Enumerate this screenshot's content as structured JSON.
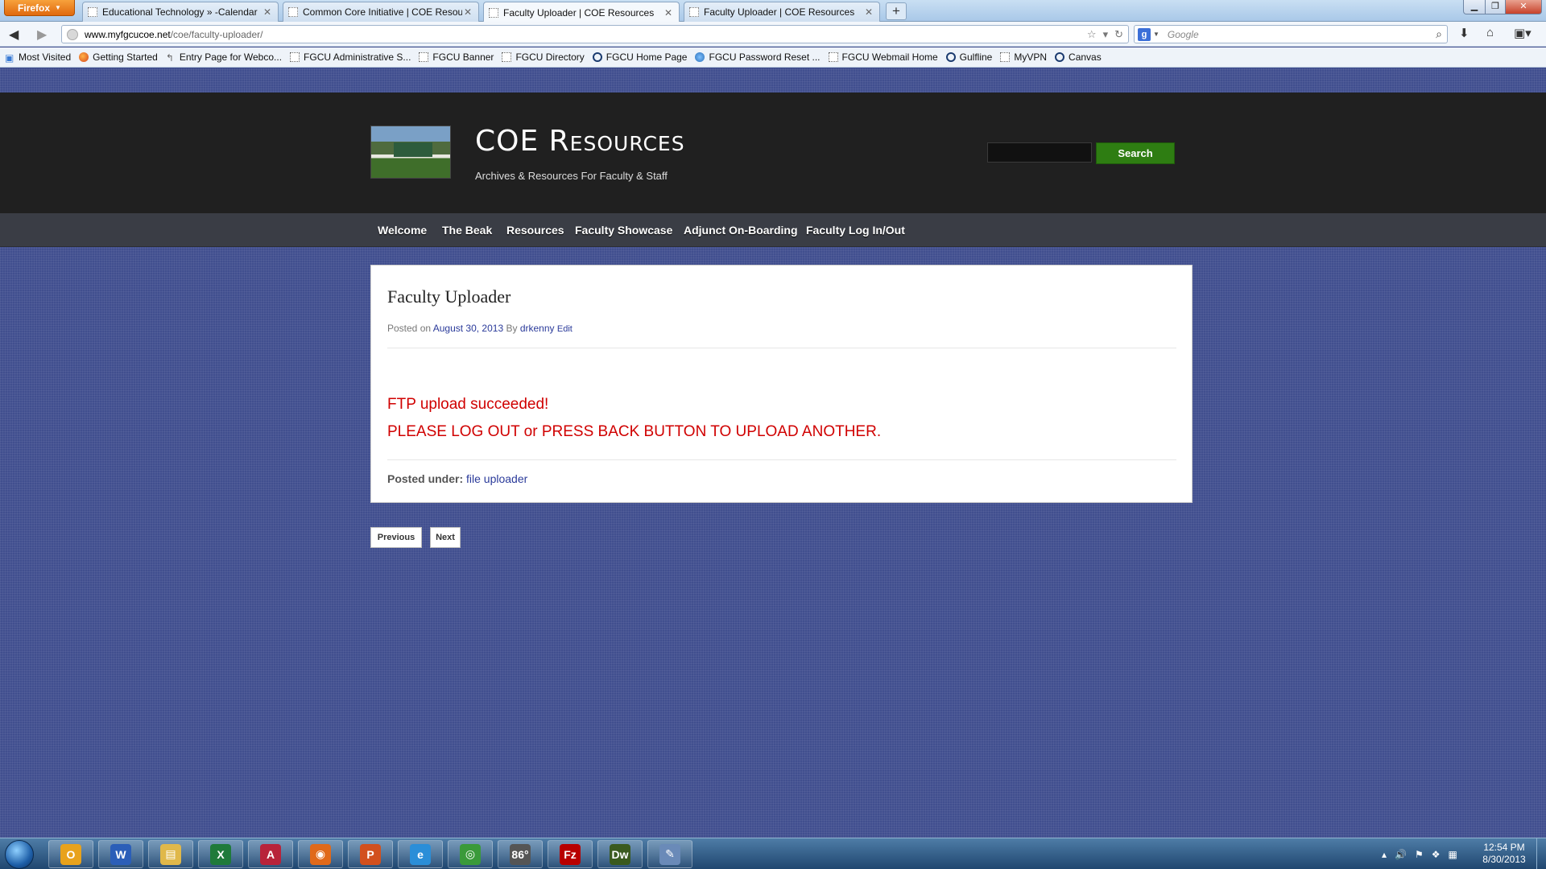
{
  "browser": {
    "app_button": "Firefox",
    "tabs": [
      {
        "label": "Educational Technology » -Calendar",
        "active": false
      },
      {
        "label": "Common Core Initiative | COE Resour...",
        "active": false
      },
      {
        "label": "Faculty Uploader | COE Resources",
        "active": true
      },
      {
        "label": "Faculty Uploader | COE Resources",
        "active": false
      }
    ],
    "new_tab": "+",
    "url_domain": "www.myfgcucoe.net",
    "url_path": "/coe/faculty-uploader/",
    "search_placeholder": "Google",
    "bookmarks": [
      {
        "label": "Most Visited",
        "icon": "star-icon"
      },
      {
        "label": "Getting Started",
        "icon": "firefox-icon"
      },
      {
        "label": "Entry Page for Webco...",
        "icon": "link-icon"
      },
      {
        "label": "FGCU Administrative S...",
        "icon": "page-icon"
      },
      {
        "label": "FGCU Banner",
        "icon": "page-icon"
      },
      {
        "label": "FGCU Directory",
        "icon": "page-icon"
      },
      {
        "label": "FGCU Home Page",
        "icon": "ring-icon"
      },
      {
        "label": "FGCU Password Reset ...",
        "icon": "globe-icon"
      },
      {
        "label": "FGCU Webmail Home",
        "icon": "page-icon"
      },
      {
        "label": "Gulfline",
        "icon": "ring-icon"
      },
      {
        "label": "MyVPN",
        "icon": "page-icon"
      },
      {
        "label": "Canvas",
        "icon": "ring-icon"
      }
    ]
  },
  "site": {
    "title": "COE Resources",
    "description": "Archives & Resources For Faculty & Staff",
    "search_button": "Search",
    "menu": [
      "Welcome",
      "The Beak",
      "Resources",
      "Faculty Showcase",
      "Adjunct On-Boarding",
      "Faculty Log In/Out"
    ]
  },
  "post": {
    "title": "Faculty Uploader",
    "posted_on_label": "Posted on",
    "date": "August 30, 2013",
    "by_label": "By",
    "author": "drkenny",
    "edit_label": "Edit",
    "message_line1": "FTP upload succeeded!",
    "message_line2": "PLEASE LOG OUT or PRESS BACK BUTTON TO UPLOAD ANOTHER.",
    "posted_under_label": "Posted under:",
    "category": "file uploader"
  },
  "pager": {
    "previous": "Previous",
    "next": "Next"
  },
  "taskbar": {
    "apps": [
      {
        "name": "outlook-app",
        "glyph": "O",
        "color": "#e8a21c"
      },
      {
        "name": "word-app",
        "glyph": "W",
        "color": "#2b5eb8"
      },
      {
        "name": "explorer-app",
        "glyph": "▤",
        "color": "#e0b84a"
      },
      {
        "name": "excel-app",
        "glyph": "X",
        "color": "#1f7a3a"
      },
      {
        "name": "access-app",
        "glyph": "A",
        "color": "#b8233a"
      },
      {
        "name": "firefox-app",
        "glyph": "◉",
        "color": "#e0691a"
      },
      {
        "name": "powerpoint-app",
        "glyph": "P",
        "color": "#d2501e"
      },
      {
        "name": "ie-app",
        "glyph": "e",
        "color": "#2a8ed8"
      },
      {
        "name": "chrome-app",
        "glyph": "◎",
        "color": "#3a9a3a"
      },
      {
        "name": "weather-app",
        "glyph": "86°",
        "color": "#555"
      },
      {
        "name": "filezilla-app",
        "glyph": "Fz",
        "color": "#b80000"
      },
      {
        "name": "dreamweaver-app",
        "glyph": "Dw",
        "color": "#3a5a1e"
      },
      {
        "name": "paint-app",
        "glyph": "✎",
        "color": "#6a8ab8"
      }
    ],
    "time": "12:54 PM",
    "date": "8/30/2013"
  }
}
